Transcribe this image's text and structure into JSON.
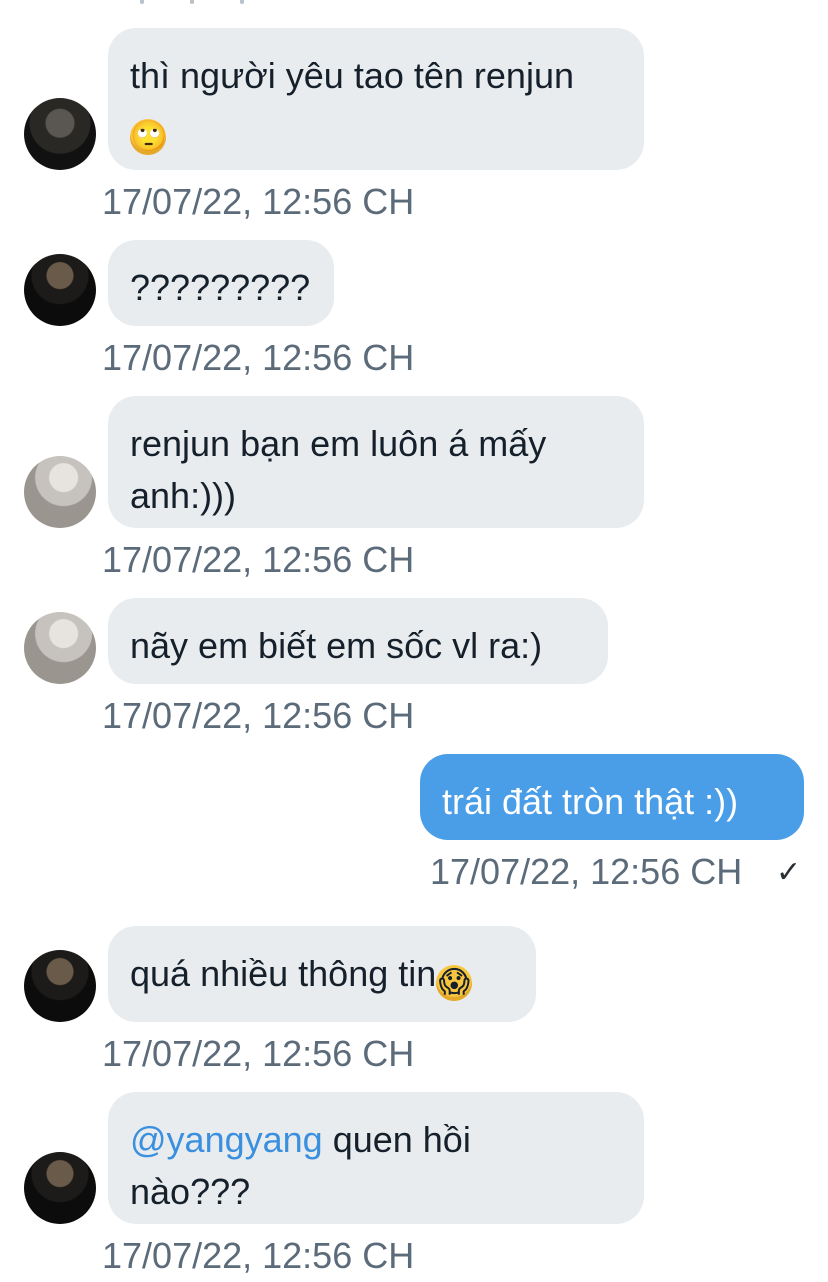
{
  "conversation": {
    "messages": [
      {
        "id": "m1",
        "direction": "incoming",
        "text": "thì người yêu tao tên renjun",
        "emoji": "🙄",
        "emoji_name": "face-with-rolling-eyes",
        "timestamp": "17/07/22, 12:56 CH"
      },
      {
        "id": "m2",
        "direction": "incoming",
        "text": "?????????",
        "timestamp": "17/07/22, 12:56 CH"
      },
      {
        "id": "m3",
        "direction": "incoming",
        "text_line1": "renjun bạn em luôn á mấy",
        "text_line2": "anh:)))",
        "timestamp": "17/07/22, 12:56 CH"
      },
      {
        "id": "m4",
        "direction": "incoming",
        "text": "nãy em biết em sốc vl ra:)",
        "timestamp": "17/07/22, 12:56 CH"
      },
      {
        "id": "m5",
        "direction": "outgoing",
        "text": "trái đất tròn thật :))",
        "timestamp": "17/07/22, 12:56 CH",
        "status_icon": "✓"
      },
      {
        "id": "m6",
        "direction": "incoming",
        "text": "quá nhiều thông tin",
        "emoji": "😱",
        "emoji_name": "face-screaming-in-fear",
        "timestamp": "17/07/22, 12:56 CH"
      },
      {
        "id": "m7",
        "direction": "incoming",
        "mention": "@yangyang",
        "text_after_mention": " quen hồi",
        "text_line2": "nào???",
        "timestamp": "17/07/22, 12:56 CH"
      }
    ]
  },
  "colors": {
    "incoming_bubble": "#e8ecef",
    "outgoing_bubble": "#4a9ee8",
    "mention": "#3a8fdf",
    "timestamp": "#5b6b7a"
  }
}
